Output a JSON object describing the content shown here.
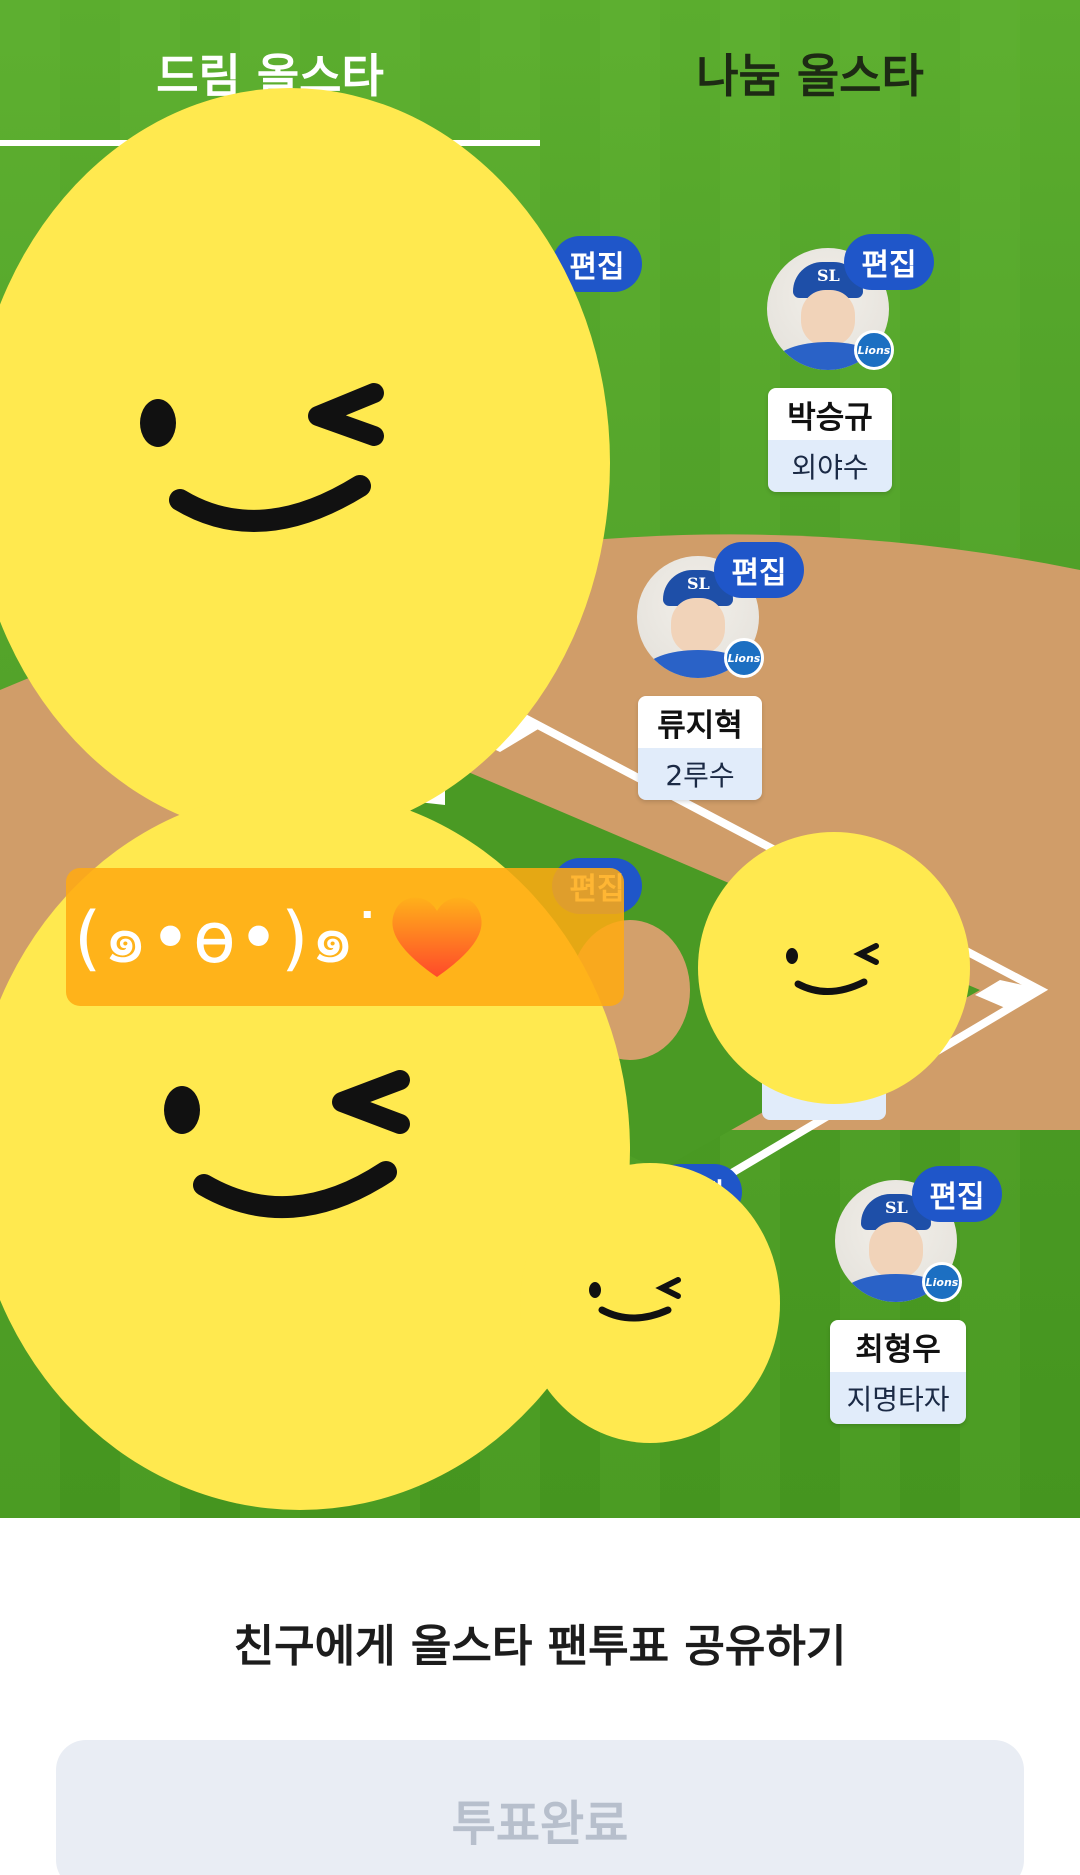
{
  "tabs": [
    {
      "label": "드림 올스타",
      "active": true
    },
    {
      "label": "나눔 올스타",
      "active": false
    }
  ],
  "edit_label": "편집",
  "badge_text": "Lions",
  "cap_logo": "SL",
  "players": [
    {
      "name": "박승규",
      "position": "외야수"
    },
    {
      "name": "류지혁",
      "position": "2루수"
    },
    {
      "name": "최형우",
      "position": "지명타자"
    }
  ],
  "kaomoji": "(๑•ө•)๑ᐝ",
  "kaomoji_heart": "♥",
  "share_title": "친구에게 올스타 팬투표 공유하기",
  "vote_button": "투표완료",
  "colors": {
    "field_green": "#4f9f28",
    "infield_dirt": "#d3a06b",
    "edit_badge": "#1f56c9",
    "smiley_yellow": "#ffe94f",
    "kaomoji_bg": "#ffaa12",
    "button_bg": "#e9edf4",
    "button_text": "#b7bfcc"
  }
}
